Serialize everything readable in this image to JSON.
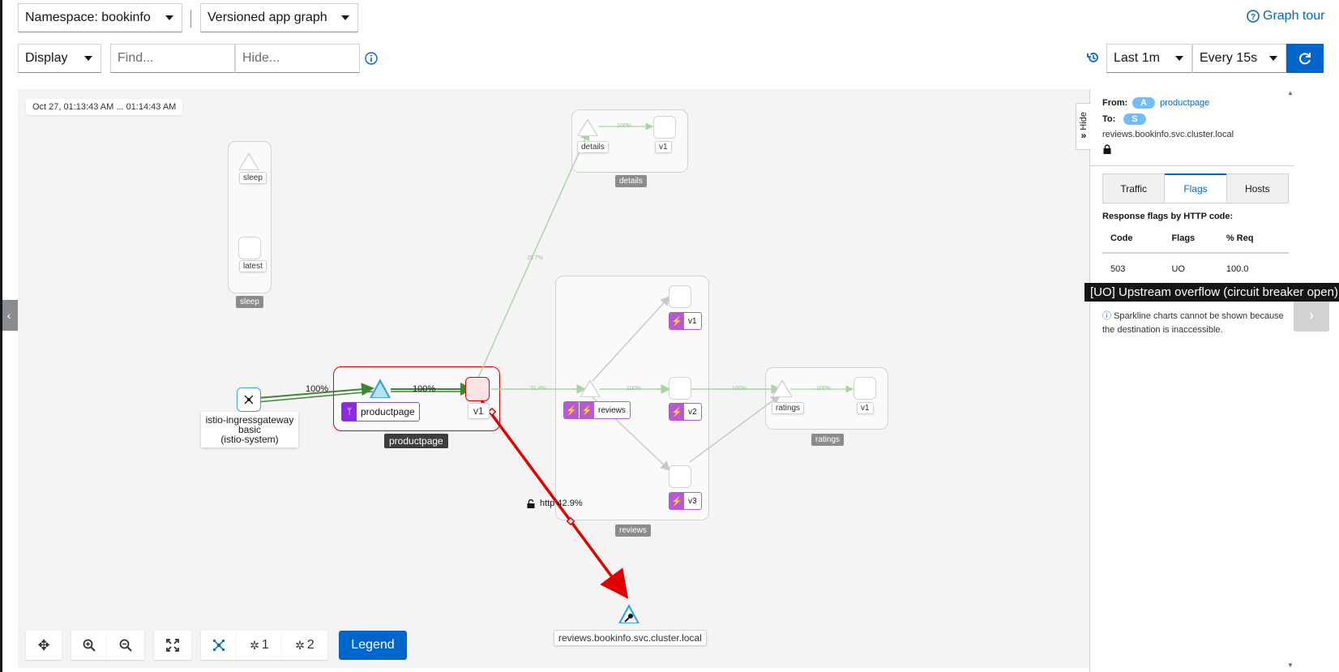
{
  "toolbar": {
    "namespace": "Namespace: bookinfo",
    "graph_type": "Versioned app graph",
    "graph_tour": "Graph tour",
    "display": "Display",
    "find_placeholder": "Find...",
    "hide_placeholder": "Hide...",
    "time_range": "Last 1m",
    "refresh_interval": "Every 15s"
  },
  "graph": {
    "timestamp": "Oct 27, 01:13:43 AM ... 01:14:43 AM",
    "groups": {
      "sleep": {
        "label": "sleep",
        "nodes": [
          "sleep",
          "latest"
        ]
      },
      "details": {
        "label": "details",
        "nodes": [
          "details",
          "v1"
        ]
      },
      "reviews": {
        "label": "reviews",
        "app": "reviews",
        "versions": [
          "v1",
          "v2",
          "v3"
        ]
      },
      "ratings": {
        "label": "ratings",
        "nodes": [
          "ratings",
          "v1"
        ]
      },
      "productpage": {
        "label": "productpage",
        "app": "productpage",
        "version": "v1"
      }
    },
    "gateway": {
      "line1": "istio-ingressgateway",
      "line2": "basic",
      "line3": "(istio-system)"
    },
    "service_entry": "reviews.bookinfo.svc.cluster.local",
    "edge_labels": {
      "gw_to_pp": "100%",
      "pp_to_v1": "100%",
      "details": "25.7%",
      "details_v1": "100%",
      "reviews": "31.4%",
      "reviews_v2": "100%",
      "ratings": "100%",
      "ratings_v1": "100%",
      "http": "http 42.9%"
    },
    "legend_button": "Legend",
    "layout_buttons": [
      "1",
      "2"
    ]
  },
  "side_panel": {
    "hide_tab": "Hide",
    "from_label": "From:",
    "from_badge": "A",
    "from_link": "productpage",
    "to_label": "To:",
    "to_badge": "S",
    "to_host": "reviews.bookinfo.svc.cluster.local",
    "tabs": [
      "Traffic",
      "Flags",
      "Hosts"
    ],
    "active_tab": "Flags",
    "section_title": "Response flags by HTTP code:",
    "table": {
      "headers": [
        "Code",
        "Flags",
        "% Req"
      ],
      "rows": [
        [
          "503",
          "UO",
          "100.0"
        ]
      ]
    },
    "note": "Sparkline charts cannot be shown because the destination is inaccessible."
  },
  "tooltip": "[UO] Upstream overflow (circuit breaker open)",
  "colors": {
    "primary": "#0066cc",
    "error": "#e00000",
    "success": "#3e8635",
    "edge_faded": "#a8d6a3",
    "app_badge": "#b659d6"
  }
}
